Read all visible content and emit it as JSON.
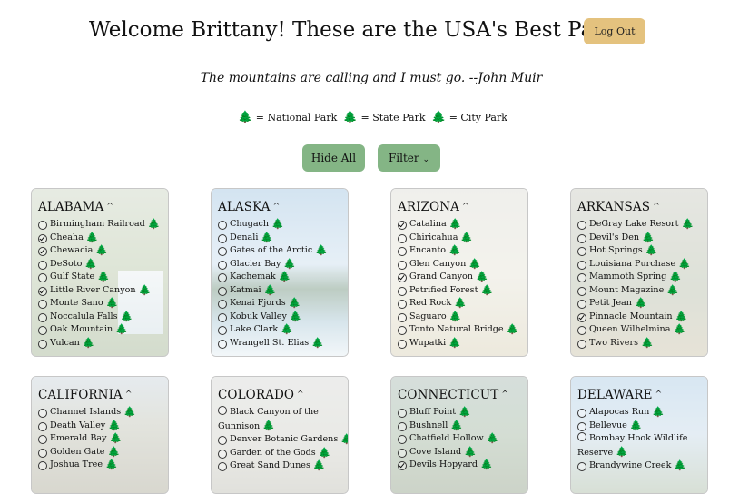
{
  "header": {
    "title": "Welcome Brittany! These are the USA's Best Parks!",
    "logout_label": "Log Out"
  },
  "quote": "The mountains are calling and I must go. --John Muir",
  "legend": {
    "national_label": "= National Park",
    "state_label": "= State Park",
    "city_label": "= City Park",
    "colors": {
      "national": "#3e8e4d",
      "state": "#b8862a",
      "city": "#d2674e"
    }
  },
  "controls": {
    "hide_all_label": "Hide All",
    "filter_label": "Filter",
    "filter_icon": "chevron-down-icon"
  },
  "accent_colors": {
    "logout": "#e4c27e",
    "buttons": "#84b585"
  },
  "states": [
    {
      "name": "ALABAMA",
      "parks": [
        {
          "name": "Birmingham Railroad",
          "type": "city",
          "checked": false
        },
        {
          "name": "Cheaha",
          "type": "state",
          "checked": true
        },
        {
          "name": "Chewacia",
          "type": "state",
          "checked": true
        },
        {
          "name": "DeSoto",
          "type": "state",
          "checked": false
        },
        {
          "name": "Gulf State",
          "type": "state",
          "checked": false
        },
        {
          "name": "Little River Canyon",
          "type": "national",
          "checked": true
        },
        {
          "name": "Monte Sano",
          "type": "state",
          "checked": false
        },
        {
          "name": "Noccalula Falls",
          "type": "city",
          "checked": false
        },
        {
          "name": "Oak Mountain",
          "type": "state",
          "checked": false
        },
        {
          "name": "Vulcan",
          "type": "city",
          "checked": false
        }
      ]
    },
    {
      "name": "ALASKA",
      "parks": [
        {
          "name": "Chugach",
          "type": "state",
          "checked": false
        },
        {
          "name": "Denali",
          "type": "national",
          "checked": false
        },
        {
          "name": "Gates of the Arctic",
          "type": "national",
          "checked": false
        },
        {
          "name": "Glacier Bay",
          "type": "national",
          "checked": false
        },
        {
          "name": "Kachemak",
          "type": "state",
          "checked": false
        },
        {
          "name": "Katmai",
          "type": "national",
          "checked": false
        },
        {
          "name": "Kenai Fjords",
          "type": "national",
          "checked": false
        },
        {
          "name": "Kobuk Valley",
          "type": "national",
          "checked": false
        },
        {
          "name": "Lake Clark",
          "type": "national",
          "checked": false
        },
        {
          "name": "Wrangell St. Elias",
          "type": "national",
          "checked": false
        }
      ]
    },
    {
      "name": "ARIZONA",
      "parks": [
        {
          "name": "Catalina",
          "type": "state",
          "checked": true
        },
        {
          "name": "Chiricahua",
          "type": "national",
          "checked": false
        },
        {
          "name": "Encanto",
          "type": "city",
          "checked": false
        },
        {
          "name": "Glen Canyon",
          "type": "national",
          "checked": false
        },
        {
          "name": "Grand Canyon",
          "type": "national",
          "checked": true
        },
        {
          "name": "Petrified Forest",
          "type": "national",
          "checked": false
        },
        {
          "name": "Red Rock",
          "type": "state",
          "checked": false
        },
        {
          "name": "Saguaro",
          "type": "national",
          "checked": false
        },
        {
          "name": "Tonto Natural Bridge",
          "type": "state",
          "checked": false
        },
        {
          "name": "Wupatki",
          "type": "national",
          "checked": false
        }
      ]
    },
    {
      "name": "ARKANSAS",
      "parks": [
        {
          "name": "DeGray Lake Resort",
          "type": "state",
          "checked": false
        },
        {
          "name": "Devil's Den",
          "type": "state",
          "checked": false
        },
        {
          "name": "Hot Springs",
          "type": "national",
          "checked": false
        },
        {
          "name": "Louisiana Purchase",
          "type": "state",
          "checked": false
        },
        {
          "name": "Mammoth Spring",
          "type": "state",
          "checked": false
        },
        {
          "name": "Mount Magazine",
          "type": "state",
          "checked": false
        },
        {
          "name": "Petit Jean",
          "type": "state",
          "checked": false
        },
        {
          "name": "Pinnacle Mountain",
          "type": "state",
          "checked": true
        },
        {
          "name": "Queen Wilhelmina",
          "type": "state",
          "checked": false
        },
        {
          "name": "Two Rivers",
          "type": "city",
          "checked": false
        }
      ]
    },
    {
      "name": "CALIFORNIA",
      "parks": [
        {
          "name": "Channel Islands",
          "type": "national",
          "checked": false
        },
        {
          "name": "Death Valley",
          "type": "national",
          "checked": false
        },
        {
          "name": "Emerald Bay",
          "type": "state",
          "checked": false
        },
        {
          "name": "Golden Gate",
          "type": "city",
          "checked": false
        },
        {
          "name": "Joshua Tree",
          "type": "national",
          "checked": false
        }
      ]
    },
    {
      "name": "COLORADO",
      "parks": [
        {
          "name": "Black Canyon of the Gunnison",
          "type": "national",
          "checked": false
        },
        {
          "name": "Denver Botanic Gardens",
          "type": "city",
          "checked": false
        },
        {
          "name": "Garden of the Gods",
          "type": "state",
          "checked": false
        },
        {
          "name": "Great Sand Dunes",
          "type": "national",
          "checked": false
        }
      ]
    },
    {
      "name": "CONNECTICUT",
      "parks": [
        {
          "name": "Bluff Point",
          "type": "state",
          "checked": false
        },
        {
          "name": "Bushnell",
          "type": "city",
          "checked": false
        },
        {
          "name": "Chatfield Hollow",
          "type": "state",
          "checked": false
        },
        {
          "name": "Cove Island",
          "type": "city",
          "checked": false
        },
        {
          "name": "Devils Hopyard",
          "type": "state",
          "checked": true
        }
      ]
    },
    {
      "name": "DELAWARE",
      "parks": [
        {
          "name": "Alapocas Run",
          "type": "state",
          "checked": false
        },
        {
          "name": "Bellevue",
          "type": "state",
          "checked": false
        },
        {
          "name": "Bombay Hook Wildlife Reserve",
          "type": "national",
          "checked": false
        },
        {
          "name": "Brandywine Creek",
          "type": "state",
          "checked": false
        }
      ]
    }
  ]
}
